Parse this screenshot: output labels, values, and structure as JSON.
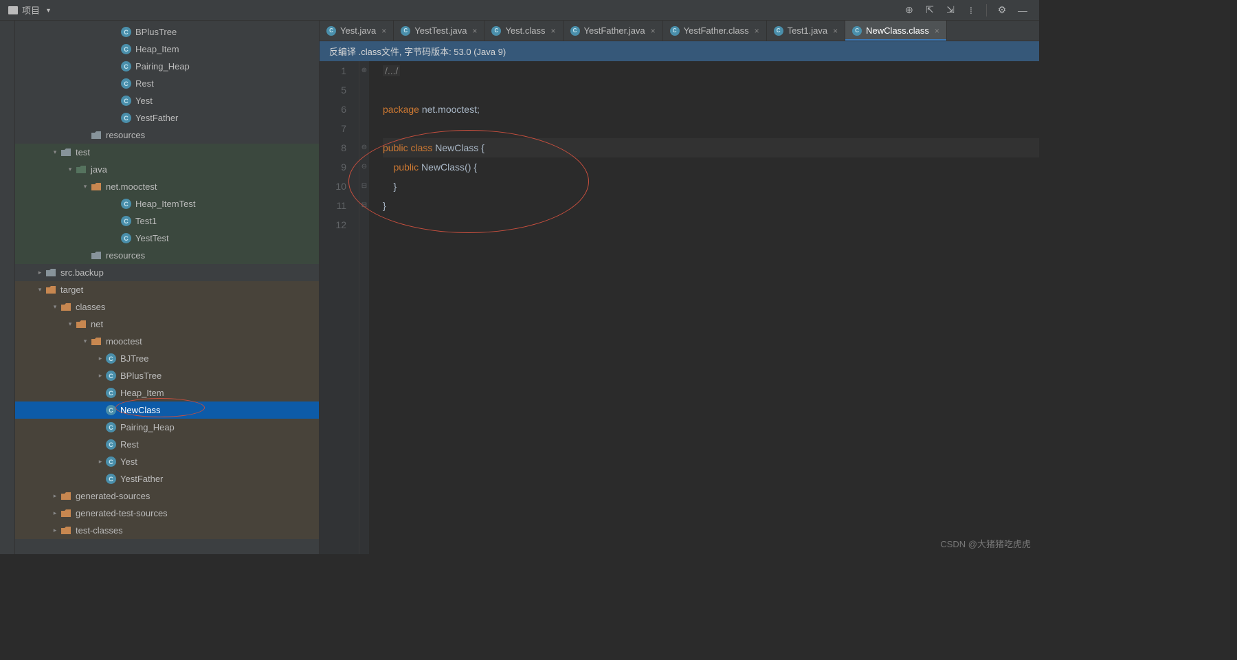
{
  "toolbar": {
    "project_label": "项目",
    "icons": {
      "target": "⊕",
      "collapse": "⇱",
      "expand": "⇲",
      "hide": "⁞",
      "gear": "⚙",
      "min": "—"
    }
  },
  "tree": [
    {
      "d": 6,
      "t": "class",
      "a": "none",
      "l": "BPlusTree"
    },
    {
      "d": 6,
      "t": "class",
      "a": "none",
      "l": "Heap_Item"
    },
    {
      "d": 6,
      "t": "class",
      "a": "none",
      "l": "Pairing_Heap"
    },
    {
      "d": 6,
      "t": "class",
      "a": "none",
      "l": "Rest"
    },
    {
      "d": 6,
      "t": "class",
      "a": "none",
      "l": "Yest"
    },
    {
      "d": 6,
      "t": "class",
      "a": "none",
      "l": "YestFather"
    },
    {
      "d": 4,
      "t": "res",
      "a": "none",
      "l": "resources"
    }
  ],
  "test_tree": [
    {
      "d": 2,
      "t": "folder",
      "a": "open",
      "l": "test"
    },
    {
      "d": 3,
      "t": "folder-green",
      "a": "open",
      "l": "java"
    },
    {
      "d": 4,
      "t": "pkg",
      "a": "open",
      "l": "net.mooctest"
    },
    {
      "d": 6,
      "t": "class",
      "a": "none",
      "l": "Heap_ItemTest"
    },
    {
      "d": 6,
      "t": "class",
      "a": "none",
      "l": "Test1"
    },
    {
      "d": 6,
      "t": "class",
      "a": "none",
      "l": "YestTest"
    },
    {
      "d": 4,
      "t": "res",
      "a": "none",
      "l": "resources"
    }
  ],
  "mid_tree": [
    {
      "d": 1,
      "t": "folder",
      "a": "closed",
      "l": "src.backup"
    }
  ],
  "target_tree": [
    {
      "d": 1,
      "t": "folder-orange",
      "a": "open",
      "l": "target"
    },
    {
      "d": 2,
      "t": "folder-orange",
      "a": "open",
      "l": "classes"
    },
    {
      "d": 3,
      "t": "folder-orange",
      "a": "open",
      "l": "net"
    },
    {
      "d": 4,
      "t": "folder-orange",
      "a": "open",
      "l": "mooctest"
    },
    {
      "d": 5,
      "t": "class",
      "a": "closed",
      "l": "BJTree"
    },
    {
      "d": 5,
      "t": "class",
      "a": "closed",
      "l": "BPlusTree"
    },
    {
      "d": 5,
      "t": "class",
      "a": "none",
      "l": "Heap_Item"
    },
    {
      "d": 5,
      "t": "class",
      "a": "none",
      "l": "NewClass",
      "selected": true
    },
    {
      "d": 5,
      "t": "class",
      "a": "none",
      "l": "Pairing_Heap"
    },
    {
      "d": 5,
      "t": "class",
      "a": "none",
      "l": "Rest"
    },
    {
      "d": 5,
      "t": "class",
      "a": "closed",
      "l": "Yest"
    },
    {
      "d": 5,
      "t": "class",
      "a": "none",
      "l": "YestFather"
    },
    {
      "d": 2,
      "t": "folder-orange",
      "a": "closed",
      "l": "generated-sources"
    },
    {
      "d": 2,
      "t": "folder-orange",
      "a": "closed",
      "l": "generated-test-sources"
    },
    {
      "d": 2,
      "t": "folder-orange",
      "a": "closed",
      "l": "test-classes"
    }
  ],
  "tabs": [
    {
      "l": "Yest.java"
    },
    {
      "l": "YestTest.java"
    },
    {
      "l": "Yest.class"
    },
    {
      "l": "YestFather.java"
    },
    {
      "l": "YestFather.class"
    },
    {
      "l": "Test1.java"
    },
    {
      "l": "NewClass.class",
      "active": true
    }
  ],
  "info_bar": "反编译 .class文件, 字节码版本: 53.0 (Java 9)",
  "gutter": [
    "1",
    "5",
    "6",
    "7",
    "8",
    "9",
    "10",
    "11",
    "12"
  ],
  "code": {
    "l1_cmt": "/.../",
    "l3_kw": "package",
    "l3_pkg": " net.mooctest",
    "l3_sc": ";",
    "l5_kw1": "public",
    "l5_kw2": "class",
    "l5_n": "NewClass",
    "l5_b": "{",
    "l6_kw": "public",
    "l6_n": "NewClass",
    "l6_p": "() {",
    "l7": "    }",
    "l8": "}"
  },
  "watermark": "CSDN @大猪猪吃虎虎"
}
